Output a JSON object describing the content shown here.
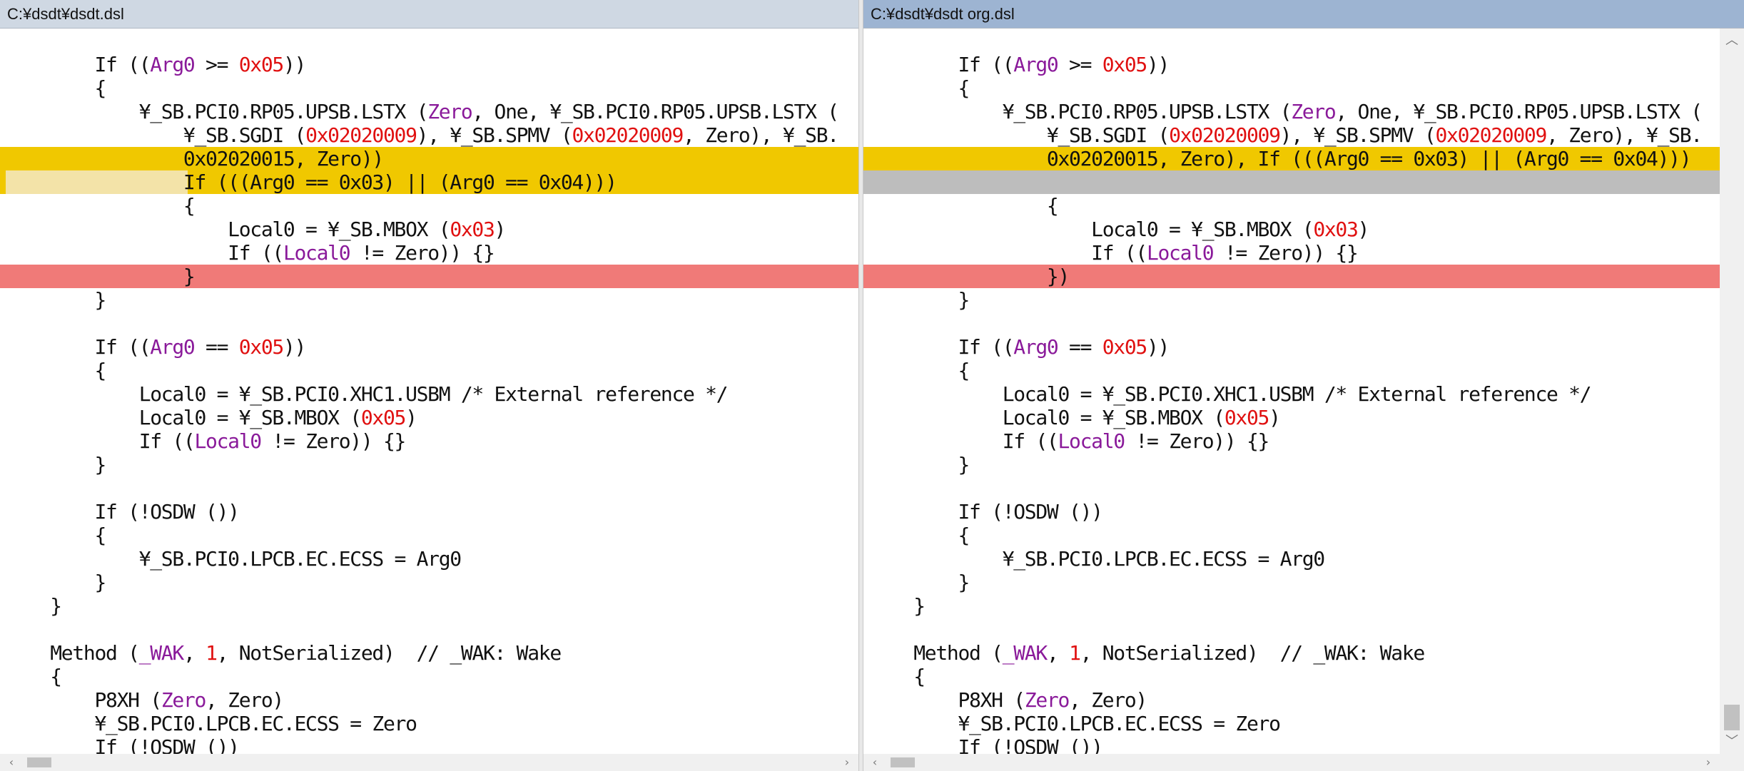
{
  "left_pane": {
    "title": "C:¥dsdt¥dsdt.dsl",
    "lines": [
      {
        "hl": "",
        "segs": [
          [
            "        If ((",
            ""
          ],
          [
            "Arg0",
            "kw"
          ],
          [
            " >= ",
            ""
          ],
          [
            "0x05",
            "num"
          ],
          [
            "))",
            ""
          ]
        ]
      },
      {
        "hl": "",
        "segs": [
          [
            "        {",
            ""
          ]
        ]
      },
      {
        "hl": "",
        "segs": [
          [
            "            ¥_SB.PCI0.RP05.UPSB.LSTX (",
            ""
          ],
          [
            "Zero",
            "kw"
          ],
          [
            ", One, ¥_SB.PCI0.RP05.UPSB.LSTX (",
            ""
          ]
        ]
      },
      {
        "hl": "",
        "segs": [
          [
            "                ¥_SB.SGDI (",
            ""
          ],
          [
            "0x02020009",
            "num"
          ],
          [
            "), ¥_SB.SPMV (",
            ""
          ],
          [
            "0x02020009",
            "num"
          ],
          [
            ", Zero), ¥_SB.",
            ""
          ]
        ]
      },
      {
        "hl": "yellow",
        "segs": [
          [
            "                0x02020015, Zero))",
            ""
          ]
        ]
      },
      {
        "hl": "yellow",
        "emptypad": "yes",
        "segs": [
          [
            "                If (((Arg0 == 0x03) || (Arg0 == 0x04)))",
            ""
          ]
        ]
      },
      {
        "hl": "",
        "segs": [
          [
            "                {",
            ""
          ]
        ]
      },
      {
        "hl": "",
        "segs": [
          [
            "                    Local0 = ¥_SB.MBOX (",
            ""
          ],
          [
            "0x03",
            "num"
          ],
          [
            ")",
            ""
          ]
        ]
      },
      {
        "hl": "",
        "segs": [
          [
            "                    If ((",
            ""
          ],
          [
            "Local0",
            "kw"
          ],
          [
            " != Zero)) {}",
            ""
          ]
        ]
      },
      {
        "hl": "red",
        "segs": [
          [
            "                }",
            ""
          ]
        ]
      },
      {
        "hl": "",
        "segs": [
          [
            "        }",
            ""
          ]
        ]
      },
      {
        "hl": "",
        "segs": [
          [
            "",
            ""
          ]
        ]
      },
      {
        "hl": "",
        "segs": [
          [
            "        If ((",
            ""
          ],
          [
            "Arg0",
            "kw"
          ],
          [
            " == ",
            ""
          ],
          [
            "0x05",
            "num"
          ],
          [
            "))",
            ""
          ]
        ]
      },
      {
        "hl": "",
        "segs": [
          [
            "        {",
            ""
          ]
        ]
      },
      {
        "hl": "",
        "segs": [
          [
            "            Local0 = ¥_SB.PCI0.XHC1.USBM /* External reference */",
            ""
          ]
        ]
      },
      {
        "hl": "",
        "segs": [
          [
            "            Local0 = ¥_SB.MBOX (",
            ""
          ],
          [
            "0x05",
            "num"
          ],
          [
            ")",
            ""
          ]
        ]
      },
      {
        "hl": "",
        "segs": [
          [
            "            If ((",
            ""
          ],
          [
            "Local0",
            "kw"
          ],
          [
            " != Zero)) {}",
            ""
          ]
        ]
      },
      {
        "hl": "",
        "segs": [
          [
            "        }",
            ""
          ]
        ]
      },
      {
        "hl": "",
        "segs": [
          [
            "",
            ""
          ]
        ]
      },
      {
        "hl": "",
        "segs": [
          [
            "        If (!OSDW ())",
            ""
          ]
        ]
      },
      {
        "hl": "",
        "segs": [
          [
            "        {",
            ""
          ]
        ]
      },
      {
        "hl": "",
        "segs": [
          [
            "            ¥_SB.PCI0.LPCB.EC.ECSS = Arg0",
            ""
          ]
        ]
      },
      {
        "hl": "",
        "segs": [
          [
            "        }",
            ""
          ]
        ]
      },
      {
        "hl": "",
        "segs": [
          [
            "    }",
            ""
          ]
        ]
      },
      {
        "hl": "",
        "segs": [
          [
            "",
            ""
          ]
        ]
      },
      {
        "hl": "",
        "segs": [
          [
            "    Method (",
            ""
          ],
          [
            "_WAK",
            "kw"
          ],
          [
            ", ",
            ""
          ],
          [
            "1",
            "num"
          ],
          [
            ", NotSerialized)  // _WAK: Wake",
            ""
          ]
        ]
      },
      {
        "hl": "",
        "segs": [
          [
            "    {",
            ""
          ]
        ]
      },
      {
        "hl": "",
        "segs": [
          [
            "        P8XH (",
            ""
          ],
          [
            "Zero",
            "kw"
          ],
          [
            ", Zero)",
            ""
          ]
        ]
      },
      {
        "hl": "",
        "segs": [
          [
            "        ¥_SB.PCI0.LPCB.EC.ECSS = Zero",
            ""
          ]
        ]
      },
      {
        "hl": "",
        "segs": [
          [
            "        If (!OSDW ())",
            ""
          ]
        ]
      }
    ]
  },
  "right_pane": {
    "title": "C:¥dsdt¥dsdt org.dsl",
    "lines": [
      {
        "hl": "",
        "segs": [
          [
            "        If ((",
            ""
          ],
          [
            "Arg0",
            "kw"
          ],
          [
            " >= ",
            ""
          ],
          [
            "0x05",
            "num"
          ],
          [
            "))",
            ""
          ]
        ]
      },
      {
        "hl": "",
        "segs": [
          [
            "        {",
            ""
          ]
        ]
      },
      {
        "hl": "",
        "segs": [
          [
            "            ¥_SB.PCI0.RP05.UPSB.LSTX (",
            ""
          ],
          [
            "Zero",
            "kw"
          ],
          [
            ", One, ¥_SB.PCI0.RP05.UPSB.LSTX (",
            ""
          ]
        ]
      },
      {
        "hl": "",
        "segs": [
          [
            "                ¥_SB.SGDI (",
            ""
          ],
          [
            "0x02020009",
            "num"
          ],
          [
            "), ¥_SB.SPMV (",
            ""
          ],
          [
            "0x02020009",
            "num"
          ],
          [
            ", Zero), ¥_SB.",
            ""
          ]
        ]
      },
      {
        "hl": "yellow",
        "segs": [
          [
            "                0x02020015, Zero), If (((Arg0 == 0x03) || (Arg0 == 0x04)))",
            ""
          ]
        ]
      },
      {
        "hl": "gray",
        "segs": [
          [
            "",
            ""
          ]
        ]
      },
      {
        "hl": "",
        "segs": [
          [
            "                {",
            ""
          ]
        ]
      },
      {
        "hl": "",
        "segs": [
          [
            "                    Local0 = ¥_SB.MBOX (",
            ""
          ],
          [
            "0x03",
            "num"
          ],
          [
            ")",
            ""
          ]
        ]
      },
      {
        "hl": "",
        "segs": [
          [
            "                    If ((",
            ""
          ],
          [
            "Local0",
            "kw"
          ],
          [
            " != Zero)) {}",
            ""
          ]
        ]
      },
      {
        "hl": "red",
        "segs": [
          [
            "                })",
            ""
          ]
        ]
      },
      {
        "hl": "",
        "segs": [
          [
            "        }",
            ""
          ]
        ]
      },
      {
        "hl": "",
        "segs": [
          [
            "",
            ""
          ]
        ]
      },
      {
        "hl": "",
        "segs": [
          [
            "        If ((",
            ""
          ],
          [
            "Arg0",
            "kw"
          ],
          [
            " == ",
            ""
          ],
          [
            "0x05",
            "num"
          ],
          [
            "))",
            ""
          ]
        ]
      },
      {
        "hl": "",
        "segs": [
          [
            "        {",
            ""
          ]
        ]
      },
      {
        "hl": "",
        "segs": [
          [
            "            Local0 = ¥_SB.PCI0.XHC1.USBM /* External reference */",
            ""
          ]
        ]
      },
      {
        "hl": "",
        "segs": [
          [
            "            Local0 = ¥_SB.MBOX (",
            ""
          ],
          [
            "0x05",
            "num"
          ],
          [
            ")",
            ""
          ]
        ]
      },
      {
        "hl": "",
        "segs": [
          [
            "            If ((",
            ""
          ],
          [
            "Local0",
            "kw"
          ],
          [
            " != Zero)) {}",
            ""
          ]
        ]
      },
      {
        "hl": "",
        "segs": [
          [
            "        }",
            ""
          ]
        ]
      },
      {
        "hl": "",
        "segs": [
          [
            "",
            ""
          ]
        ]
      },
      {
        "hl": "",
        "segs": [
          [
            "        If (!OSDW ())",
            ""
          ]
        ]
      },
      {
        "hl": "",
        "segs": [
          [
            "        {",
            ""
          ]
        ]
      },
      {
        "hl": "",
        "segs": [
          [
            "            ¥_SB.PCI0.LPCB.EC.ECSS = Arg0",
            ""
          ]
        ]
      },
      {
        "hl": "",
        "segs": [
          [
            "        }",
            ""
          ]
        ]
      },
      {
        "hl": "",
        "segs": [
          [
            "    }",
            ""
          ]
        ]
      },
      {
        "hl": "",
        "segs": [
          [
            "",
            ""
          ]
        ]
      },
      {
        "hl": "",
        "segs": [
          [
            "    Method (",
            ""
          ],
          [
            "_WAK",
            "kw"
          ],
          [
            ", ",
            ""
          ],
          [
            "1",
            "num"
          ],
          [
            ", NotSerialized)  // _WAK: Wake",
            ""
          ]
        ]
      },
      {
        "hl": "",
        "segs": [
          [
            "    {",
            ""
          ]
        ]
      },
      {
        "hl": "",
        "segs": [
          [
            "        P8XH (",
            ""
          ],
          [
            "Zero",
            "kw"
          ],
          [
            ", Zero)",
            ""
          ]
        ]
      },
      {
        "hl": "",
        "segs": [
          [
            "        ¥_SB.PCI0.LPCB.EC.ECSS = Zero",
            ""
          ]
        ]
      },
      {
        "hl": "",
        "segs": [
          [
            "        If (!OSDW ())",
            ""
          ]
        ]
      }
    ]
  },
  "scroll_icons": {
    "up": "︿",
    "down": "﹀",
    "left": "‹",
    "right": "›"
  },
  "colors": {
    "changed": "#f0c800",
    "deleted": "#f07a78",
    "missing": "#bdbdbd",
    "number": "#e01010",
    "keyword": "#8a1a9a"
  }
}
